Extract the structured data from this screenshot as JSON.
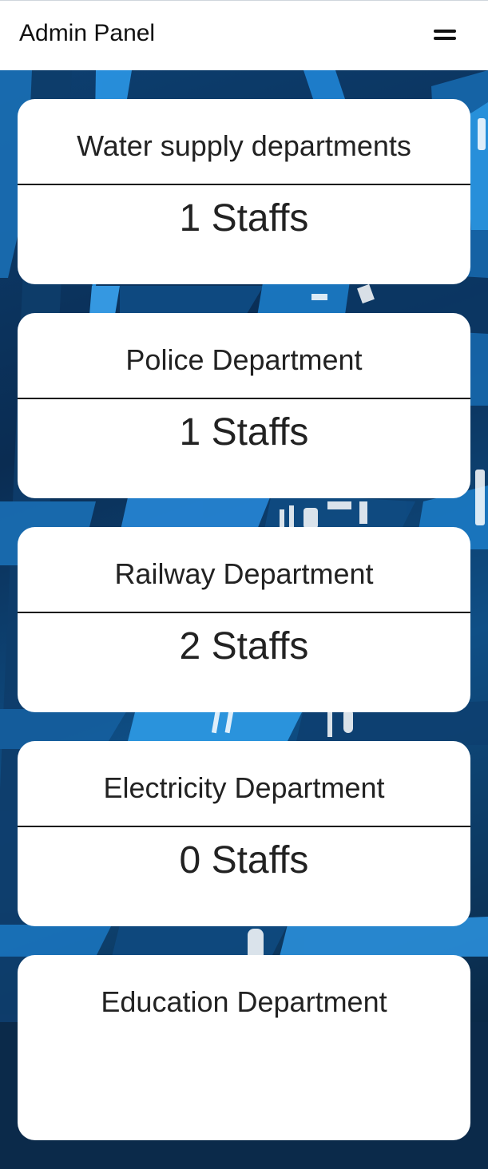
{
  "header": {
    "title": "Admin Panel",
    "menu_icon": "hamburger-menu-icon"
  },
  "departments": [
    {
      "name": "Water supply departments",
      "count": "1 Staffs"
    },
    {
      "name": "Police Department",
      "count": "1 Staffs"
    },
    {
      "name": "Railway Department",
      "count": "2 Staffs"
    },
    {
      "name": "Electricity Department",
      "count": "0 Staffs"
    },
    {
      "name": "Education Department",
      "count": ""
    }
  ],
  "colors": {
    "header_bg": "#ffffff",
    "card_bg": "#ffffff",
    "background_dark": "#0b2a4a",
    "background_accent": "#1e88d8",
    "text": "#222222"
  }
}
